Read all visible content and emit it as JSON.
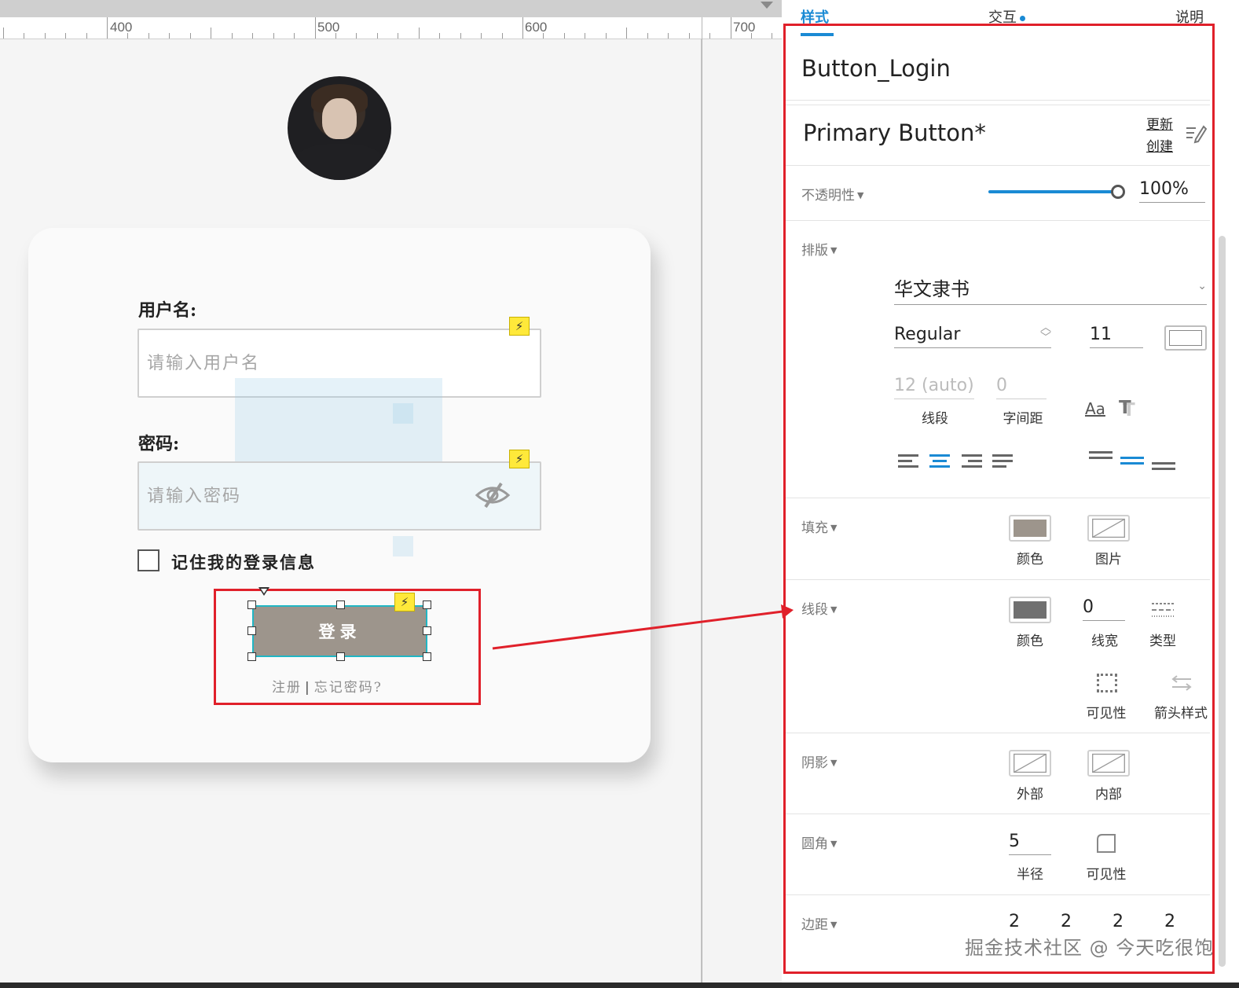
{
  "ruler": {
    "labels": [
      "400",
      "500",
      "600",
      "700"
    ]
  },
  "form": {
    "username_label": "用户名:",
    "username_placeholder": "请输入用户名",
    "password_label": "密码:",
    "password_placeholder": "请输入密码",
    "remember_label": "记住我的登录信息",
    "login_button": "登录",
    "register_link": "注册",
    "link_separator": "|",
    "forgot_link": "忘记密码?"
  },
  "panel": {
    "tabs": {
      "style": "样式",
      "interaction": "交互",
      "notes": "说明"
    },
    "widget_name": "Button_Login",
    "style_name": "Primary Button*",
    "update_link": "更新",
    "create_link": "创建",
    "opacity": {
      "label": "不透明性",
      "value": "100%",
      "level": 1.0
    },
    "typography": {
      "label": "排版",
      "font_family": "华文隶书",
      "font_weight": "Regular",
      "font_size": "11",
      "line_spacing": "12 (auto)",
      "line_spacing_label": "线段",
      "char_spacing": "0",
      "char_spacing_label": "字间距",
      "text_case_glyph": "Aa",
      "text_shadow_glyph": "T"
    },
    "fill": {
      "label": "填充",
      "color_label": "颜色",
      "image_label": "图片",
      "color": "#9d958c"
    },
    "border": {
      "label": "线段",
      "color_label": "颜色",
      "width": "0",
      "width_label": "线宽",
      "type_label": "类型",
      "visibility_label": "可见性",
      "arrow_label": "箭头样式",
      "color": "#707070"
    },
    "shadow": {
      "label": "阴影",
      "outer_label": "外部",
      "inner_label": "内部"
    },
    "corner": {
      "label": "圆角",
      "radius": "5",
      "radius_label": "半径",
      "visibility_label": "可见性"
    },
    "padding": {
      "label": "边距",
      "left": "2",
      "top": "2",
      "right": "2",
      "bottom": "2"
    }
  },
  "watermark": "掘金技术社区 @ 今天吃很饱",
  "colors": {
    "accent": "#1a8ad4",
    "highlight_red": "#e0202a",
    "button": "#9d958c",
    "selection": "#20b6c4"
  }
}
